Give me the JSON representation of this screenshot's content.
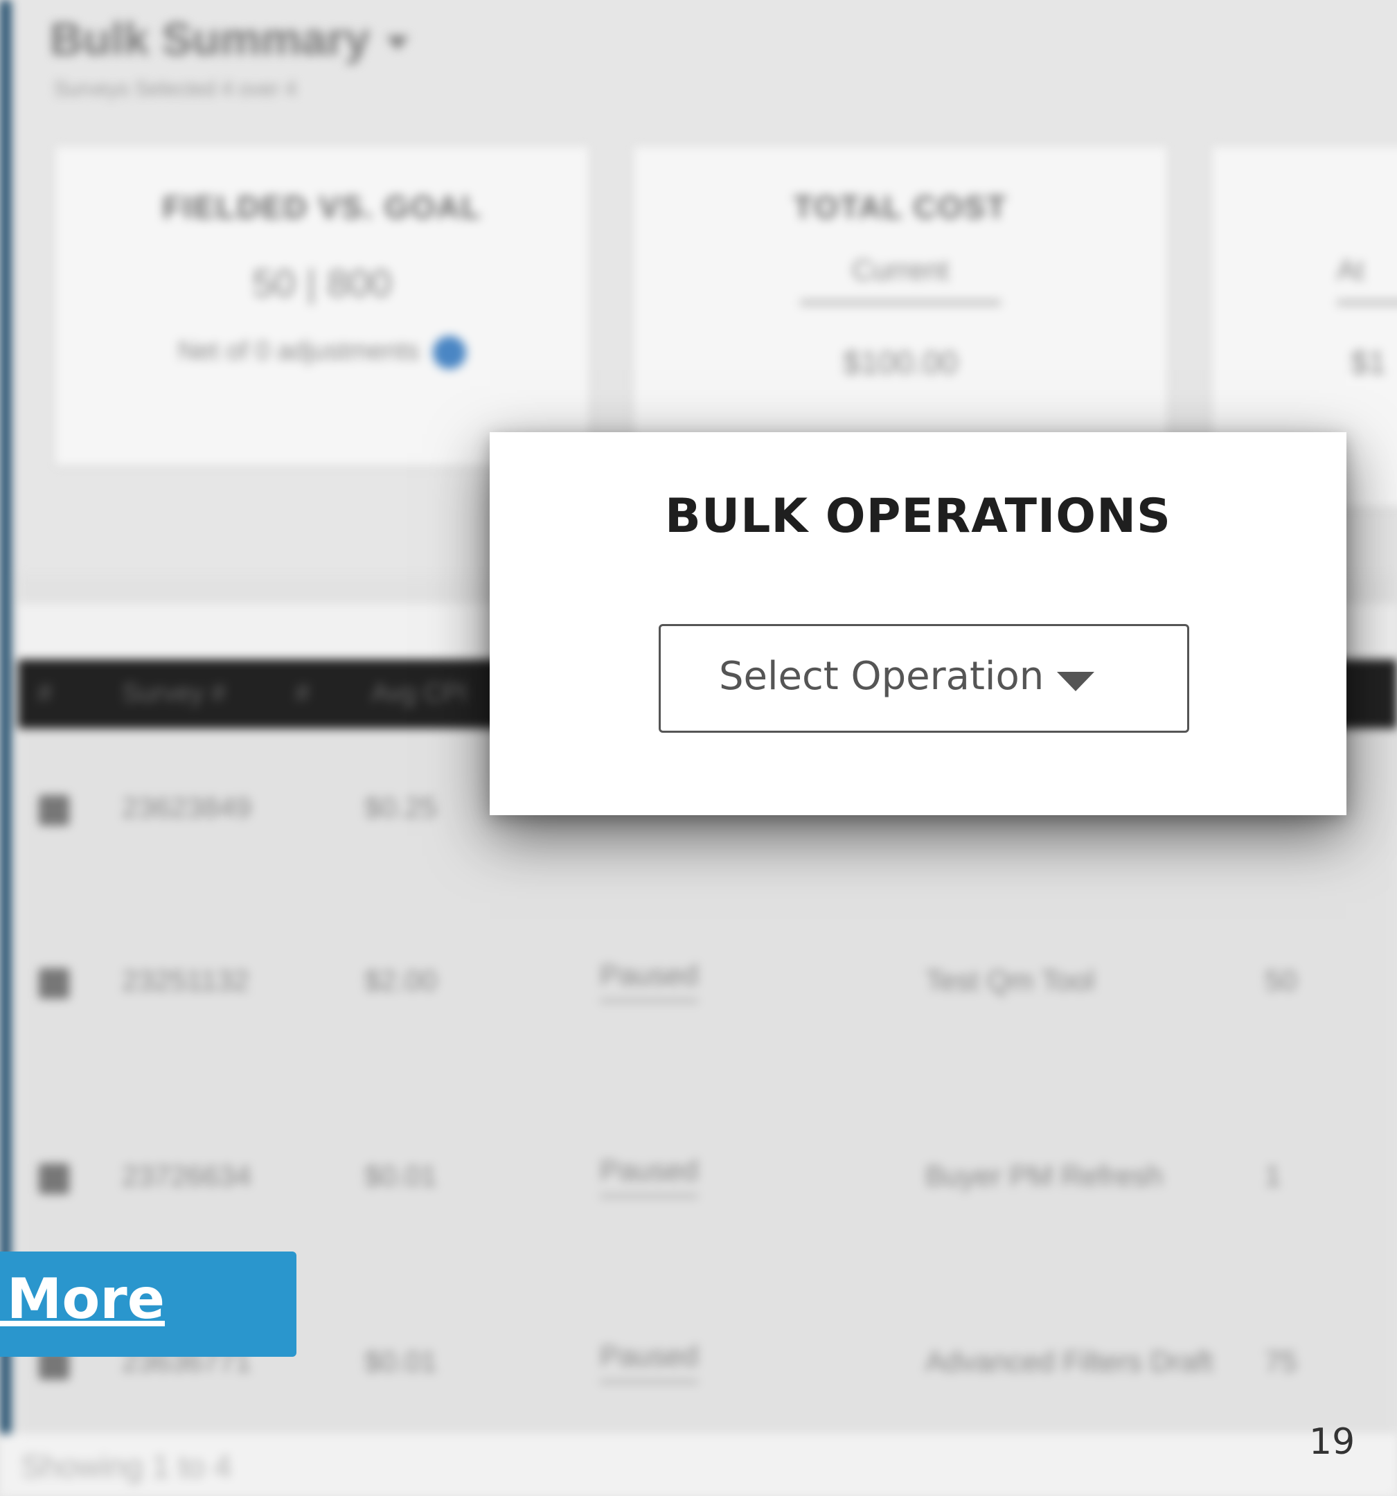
{
  "background": {
    "page_title": "Bulk Summary",
    "page_subtitle": "Surveys Selected 4 over 4",
    "cards": [
      {
        "title": "FIELDED VS. GOAL",
        "value": "50 | 800",
        "note": "Net of 0 adjustments"
      },
      {
        "title": "TOTAL COST",
        "label": "Current",
        "value": "$100.00"
      },
      {
        "title": "",
        "label": "At",
        "value": "$1"
      }
    ],
    "table": {
      "headers": [
        "#",
        "Survey #",
        "#",
        "Avg CPI"
      ],
      "rows": [
        {
          "survey": "23623849",
          "cpi": "$0.25",
          "status": "",
          "name": "",
          "count": ""
        },
        {
          "survey": "23251132",
          "cpi": "$2.00",
          "status": "Paused",
          "name": "Test Qm Tool",
          "count": "50"
        },
        {
          "survey": "23726634",
          "cpi": "$0.01",
          "status": "Paused",
          "name": "Buyer PM Refresh",
          "count": "1"
        },
        {
          "survey": "23636771",
          "cpi": "$0.01",
          "status": "Paused",
          "name": "Advanced Filters Draft",
          "count": "75"
        }
      ]
    },
    "footer_text": "Showing 1 to 4"
  },
  "modal": {
    "title": "BULK OPERATIONS",
    "select_placeholder": "Select Operation"
  },
  "learn_more_label": "Learn More",
  "slide_number": "19",
  "colors": {
    "sidebar": "#1d4a6a",
    "button": "#2a96cd",
    "info_badge": "#4a86c4"
  }
}
